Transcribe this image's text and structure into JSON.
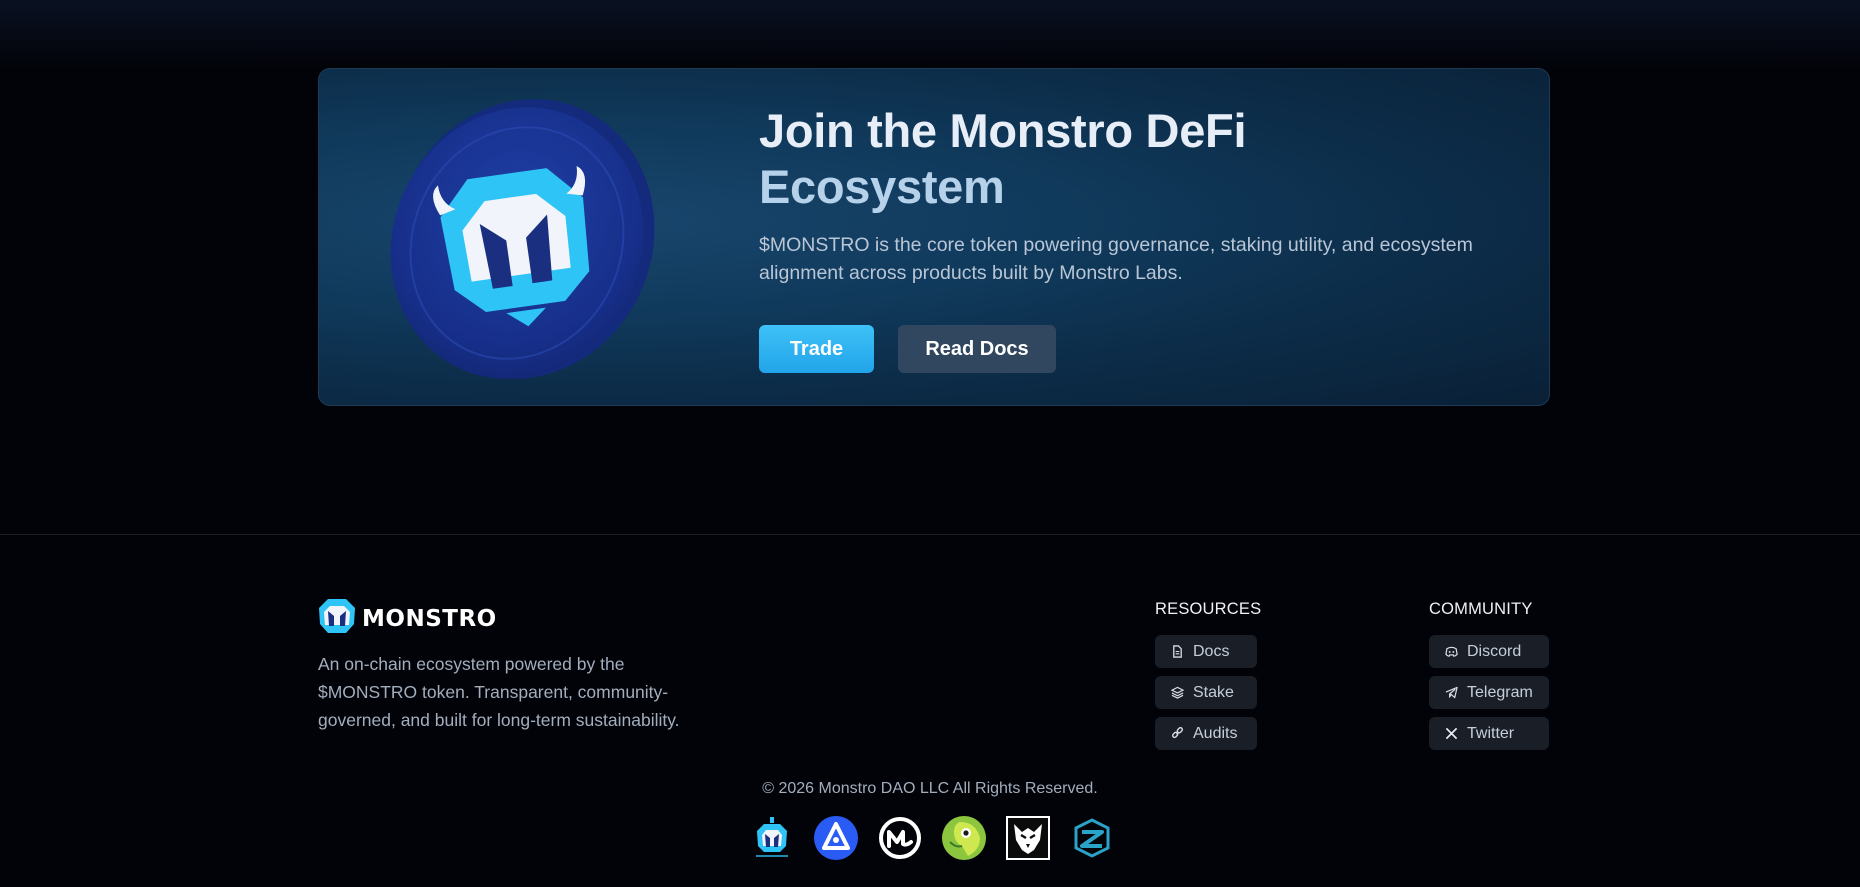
{
  "hero": {
    "title_line1": "Join the Monstro DeFi",
    "title_line2": "Ecosystem",
    "description": "$MONSTRO is the core token powering governance, staking utility, and ecosystem alignment across products built by Monstro Labs.",
    "trade_label": "Trade",
    "read_docs_label": "Read Docs"
  },
  "footer": {
    "brand_name": "MONSTRO",
    "brand_description": "An on-chain ecosystem powered by the $MONSTRO token. Transparent, community-governed, and built for long-term sustainability.",
    "resources": {
      "title": "RESOURCES",
      "items": [
        {
          "label": "Docs",
          "icon": "document-icon"
        },
        {
          "label": "Stake",
          "icon": "layers-icon"
        },
        {
          "label": "Audits",
          "icon": "link-icon"
        }
      ]
    },
    "community": {
      "title": "COMMUNITY",
      "items": [
        {
          "label": "Discord",
          "icon": "discord-icon"
        },
        {
          "label": "Telegram",
          "icon": "telegram-icon"
        },
        {
          "label": "Twitter",
          "icon": "x-icon"
        }
      ]
    },
    "copyright": "© 2026 Monstro DAO LLC All Rights Reserved.",
    "partners": [
      "monstro-labs-logo",
      "avalanche-alpha-logo",
      "coinmarketcap-logo",
      "coingecko-logo",
      "eagle-logo",
      "zerion-logo"
    ]
  },
  "colors": {
    "background": "#020308",
    "accent": "#2bb0f0",
    "card": "#103a5c",
    "pill": "#1a1f27"
  }
}
